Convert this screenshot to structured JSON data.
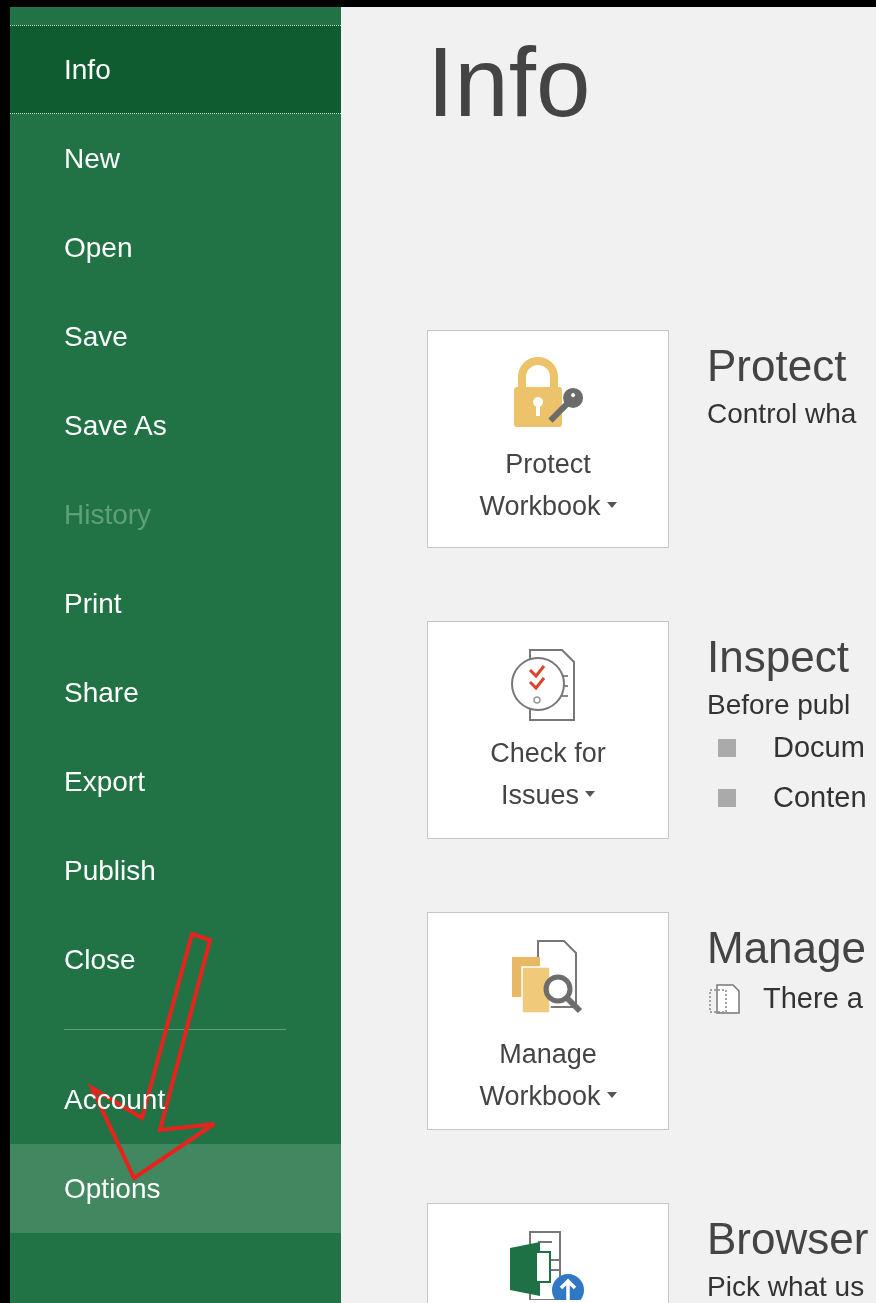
{
  "sidebar": {
    "top_items": [
      {
        "label": "Info",
        "selected": true,
        "hovered": false,
        "disabled": false
      },
      {
        "label": "New",
        "selected": false,
        "hovered": false,
        "disabled": false
      },
      {
        "label": "Open",
        "selected": false,
        "hovered": false,
        "disabled": false
      },
      {
        "label": "Save",
        "selected": false,
        "hovered": false,
        "disabled": false
      },
      {
        "label": "Save As",
        "selected": false,
        "hovered": false,
        "disabled": false
      },
      {
        "label": "History",
        "selected": false,
        "hovered": false,
        "disabled": true
      },
      {
        "label": "Print",
        "selected": false,
        "hovered": false,
        "disabled": false
      },
      {
        "label": "Share",
        "selected": false,
        "hovered": false,
        "disabled": false
      },
      {
        "label": "Export",
        "selected": false,
        "hovered": false,
        "disabled": false
      },
      {
        "label": "Publish",
        "selected": false,
        "hovered": false,
        "disabled": false
      },
      {
        "label": "Close",
        "selected": false,
        "hovered": false,
        "disabled": false
      }
    ],
    "bottom_items": [
      {
        "label": "Account",
        "selected": false,
        "hovered": false,
        "disabled": false
      },
      {
        "label": "Options",
        "selected": false,
        "hovered": true,
        "disabled": false
      }
    ]
  },
  "main": {
    "title": "Info",
    "sections": [
      {
        "tile": {
          "kind": "lock",
          "lines": [
            "Protect",
            "Workbook"
          ],
          "dropdown": true
        },
        "heading": "Protect",
        "description": "Control wha"
      },
      {
        "tile": {
          "kind": "inspect",
          "lines": [
            "Check for",
            "Issues"
          ],
          "dropdown": true
        },
        "heading": "Inspect",
        "description": "Before publ",
        "entries": [
          {
            "kind": "bullet",
            "text": "Docum"
          },
          {
            "kind": "bullet",
            "text": "Conten"
          }
        ]
      },
      {
        "tile": {
          "kind": "manage",
          "lines": [
            "Manage",
            "Workbook"
          ],
          "dropdown": true
        },
        "heading": "Manage",
        "entries": [
          {
            "kind": "file",
            "text": "There a"
          }
        ]
      },
      {
        "tile": {
          "kind": "browser",
          "dropdown": false
        },
        "heading": "Browser",
        "description": "Pick what us"
      }
    ]
  },
  "annotation": {
    "kind": "arrow"
  }
}
